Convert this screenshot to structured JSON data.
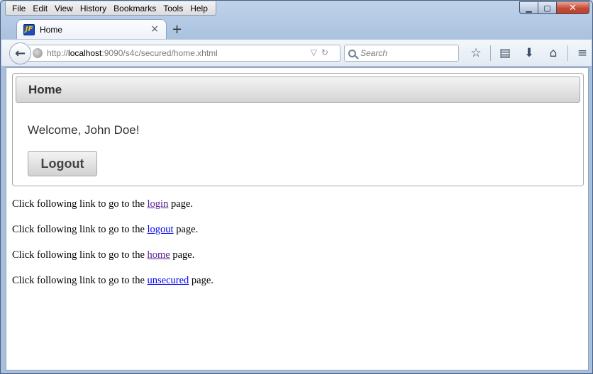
{
  "menubar": {
    "items": [
      "File",
      "Edit",
      "View",
      "History",
      "Bookmarks",
      "Tools",
      "Help"
    ]
  },
  "window_controls": {
    "minimize": "▁",
    "maximize": "▢",
    "close": "✕"
  },
  "tab": {
    "title": "Home",
    "favicon_text": "JF",
    "close": "×",
    "new_tab": "+"
  },
  "navbar": {
    "url_prefix": "http://",
    "url_host": "localhost",
    "url_rest": ":9090/s4c/secured/home.xhtml",
    "search_placeholder": "Search",
    "icons": [
      "star-icon",
      "reading-list-icon",
      "download-icon",
      "home-icon",
      "menu-icon"
    ]
  },
  "panel": {
    "title": "Home",
    "welcome": "Welcome, John Doe!",
    "logout_label": "Logout"
  },
  "links": [
    {
      "prefix": "Click following link to go to the ",
      "link": "login",
      "suffix": " page.",
      "visited": true
    },
    {
      "prefix": "Click following link to go to the ",
      "link": "logout",
      "suffix": " page.",
      "visited": false
    },
    {
      "prefix": "Click following link to go to the ",
      "link": "home",
      "suffix": " page.",
      "visited": true
    },
    {
      "prefix": "Click following link to go to the ",
      "link": "unsecured",
      "suffix": " page.",
      "visited": false
    }
  ]
}
